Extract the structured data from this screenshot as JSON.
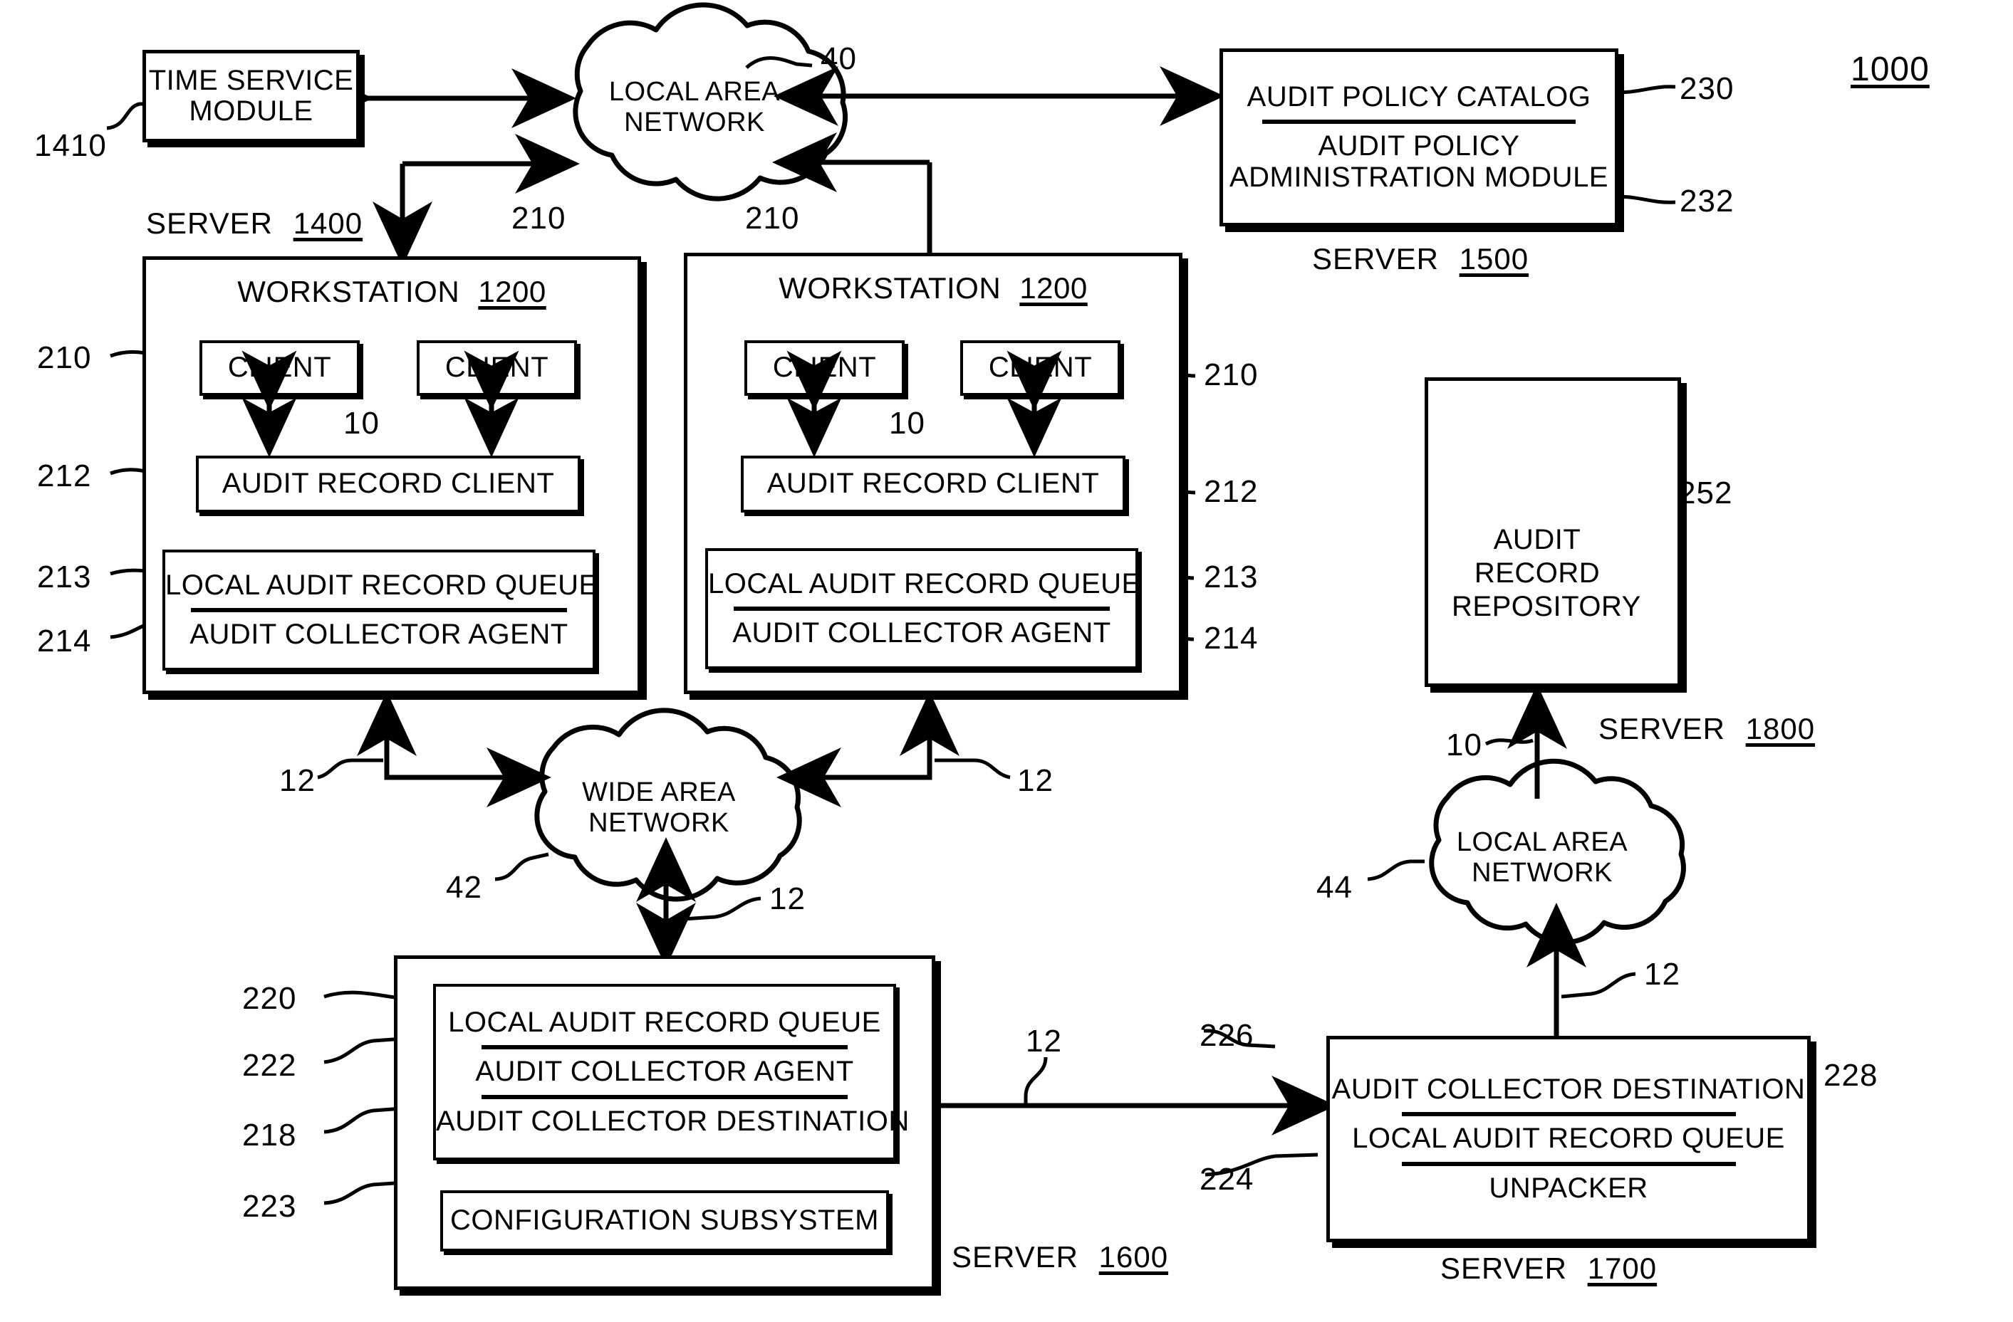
{
  "figure": {
    "number": "1000"
  },
  "nodes": {
    "time_service_module": {
      "line1": "TIME SERVICE",
      "line2": "MODULE",
      "ref": "1410"
    },
    "lan_top": {
      "line1": "LOCAL AREA",
      "line2": "NETWORK",
      "ref": "40"
    },
    "audit_policy_server": {
      "catalog": "AUDIT POLICY CATALOG",
      "catalog_ref": "230",
      "admin_line1": "AUDIT POLICY",
      "admin_line2": "ADMINISTRATION MODULE",
      "admin_ref": "232",
      "caption_word": "SERVER",
      "caption_num": "1500"
    },
    "server_1400": {
      "caption_word": "SERVER",
      "caption_num": "1400",
      "workstation_title": "WORKSTATION",
      "workstation_num": "1200",
      "client_left": "CLIENT",
      "client_right": "CLIENT",
      "client_ref": "210",
      "client_ref_right": "210",
      "link_ref": "10",
      "audit_record_client": "AUDIT RECORD CLIENT",
      "audit_record_client_ref": "212",
      "local_queue": "LOCAL AUDIT RECORD QUEUE",
      "local_queue_ref": "213",
      "collector_agent": "AUDIT COLLECTOR AGENT",
      "collector_agent_ref": "214"
    },
    "server_1400b": {
      "workstation_title": "WORKSTATION",
      "workstation_num": "1200",
      "client_left": "CLIENT",
      "client_right": "CLIENT",
      "client_ref": "210",
      "client_ref_right": "210",
      "link_ref": "10",
      "audit_record_client": "AUDIT RECORD CLIENT",
      "audit_record_client_ref": "212",
      "local_queue": "LOCAL AUDIT RECORD QUEUE",
      "local_queue_ref": "213",
      "collector_agent": "AUDIT COLLECTOR AGENT",
      "collector_agent_ref": "214"
    },
    "repository_server": {
      "line1": "AUDIT",
      "line2": "RECORD",
      "line3": "REPOSITORY",
      "ref": "252",
      "link_ref": "10",
      "caption_word": "SERVER",
      "caption_num": "1800"
    },
    "wan": {
      "line1": "WIDE AREA",
      "line2": "NETWORK",
      "ref": "42"
    },
    "lan_bottom": {
      "line1": "LOCAL AREA",
      "line2": "NETWORK",
      "ref": "44"
    },
    "server_1600": {
      "local_queue": "LOCAL AUDIT RECORD QUEUE",
      "local_queue_ref": "220",
      "collector_agent": "AUDIT COLLECTOR AGENT",
      "collector_agent_ref": "222",
      "collector_destination": "AUDIT COLLECTOR DESTINATION",
      "collector_destination_ref": "218",
      "config_subsystem": "CONFIGURATION SUBSYSTEM",
      "config_subsystem_ref": "223",
      "caption_word": "SERVER",
      "caption_num": "1600"
    },
    "server_1700": {
      "collector_destination": "AUDIT COLLECTOR DESTINATION",
      "collector_destination_ref": "226",
      "local_queue": "LOCAL AUDIT RECORD QUEUE",
      "local_queue_ref": "228",
      "unpacker": "UNPACKER",
      "unpacker_ref": "224",
      "caption_word": "SERVER",
      "caption_num": "1700"
    }
  },
  "link_refs": {
    "wan_left": "12",
    "wan_right": "12",
    "wan_bottom": "12",
    "server_to_server": "12",
    "lan_bottom_up": "12"
  }
}
